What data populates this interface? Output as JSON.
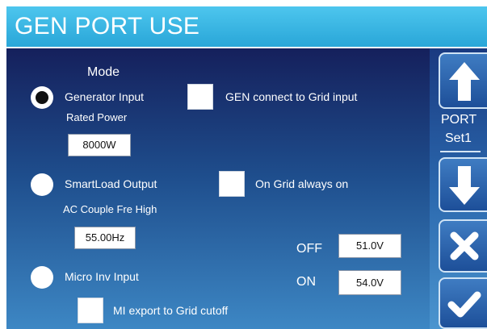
{
  "header": {
    "title": "GEN PORT USE"
  },
  "mode": {
    "label": "Mode",
    "generator_input": {
      "label": "Generator Input",
      "selected": true
    },
    "gen_connect_grid": {
      "label": "GEN connect to Grid input",
      "checked": false
    },
    "rated_power": {
      "label": "Rated Power",
      "value": "8000W"
    },
    "smartload_output": {
      "label": "SmartLoad Output",
      "selected": false
    },
    "on_grid_always_on": {
      "label": "On Grid always on",
      "checked": false
    },
    "ac_couple_fre_high": {
      "label": "AC Couple Fre High",
      "value": "55.00Hz"
    },
    "off_voltage": {
      "label": "OFF",
      "value": "51.0V"
    },
    "on_voltage": {
      "label": "ON",
      "value": "54.0V"
    },
    "micro_inv_input": {
      "label": "Micro Inv Input",
      "selected": false
    },
    "mi_export_cutoff": {
      "label": "MI export to Grid cutoff",
      "checked": false
    }
  },
  "side": {
    "port_label": "PORT",
    "set_label": "Set1",
    "icons": [
      "arrow-up-icon",
      "arrow-down-icon",
      "close-icon",
      "checkmark-icon"
    ]
  },
  "colors": {
    "header": "#29a6d8",
    "panel_top": "#15205c",
    "panel_bottom": "#3d87c4"
  }
}
